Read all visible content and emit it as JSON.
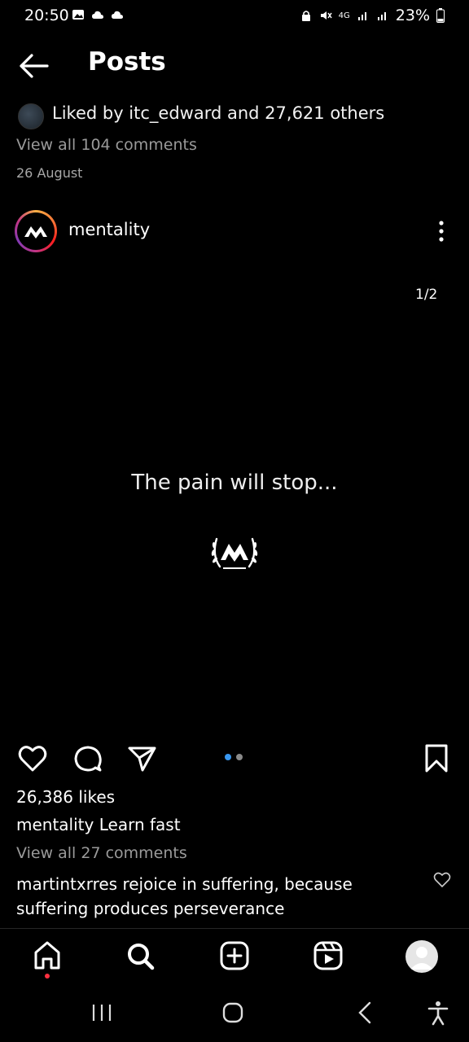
{
  "status_bar": {
    "time": "20:50",
    "battery": "23%",
    "network": "4G",
    "left_icons": [
      "gallery-icon",
      "cloud-icon",
      "cloud-icon"
    ],
    "right_icons": [
      "lock-icon",
      "mute-icon",
      "signal-icon",
      "signal-icon",
      "battery-icon"
    ]
  },
  "header": {
    "title": "Posts"
  },
  "previous_post": {
    "liked_by": "Liked by itc_edward and 27,621 others",
    "view_comments": "View all 104 comments",
    "date": "26 August"
  },
  "post": {
    "username": "mentality",
    "counter": "1/2",
    "quote": "The pain will stop...",
    "likes": "26,386 likes",
    "caption_user": "mentality",
    "caption_text": "Learn fast",
    "view_comments": "View all 27 comments",
    "comment_user": "martintxrres",
    "comment_text": "rejoice in suffering, because suffering produces perseverance",
    "carousel_active_index": 1,
    "carousel_total": 2
  },
  "colors": {
    "accent_blue": "#3897f0",
    "notification_red": "#ff3040",
    "background": "#000000"
  },
  "bottom_nav": [
    "home-icon",
    "search-icon",
    "add-icon",
    "reels-icon",
    "profile-icon"
  ],
  "system_nav": [
    "recent-apps-icon",
    "home-button-icon",
    "back-button-icon",
    "accessibility-icon"
  ]
}
